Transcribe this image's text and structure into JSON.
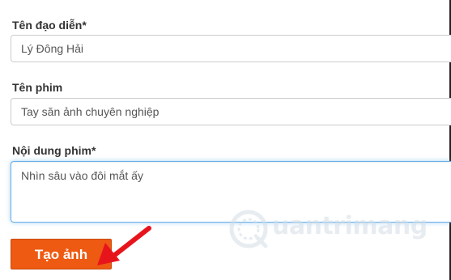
{
  "form": {
    "director": {
      "label": "Tên đạo diễn*",
      "value": "Lý Đông Hải"
    },
    "movie": {
      "label": "Tên phim",
      "value": "Tay săn ảnh chuyên nghiệp"
    },
    "content": {
      "label": "Nội dung phim*",
      "value": "Nhìn sâu vào đôi mắt ấy"
    },
    "submit_label": "Tạo ảnh"
  },
  "watermark": {
    "text": "uantrimang",
    "icon": "quantrimang-logo-icon"
  },
  "annotation": {
    "icon": "red-arrow-icon",
    "color": "#e8141c"
  },
  "colors": {
    "button": "#ee5a12",
    "focus_border": "#66afe9"
  }
}
